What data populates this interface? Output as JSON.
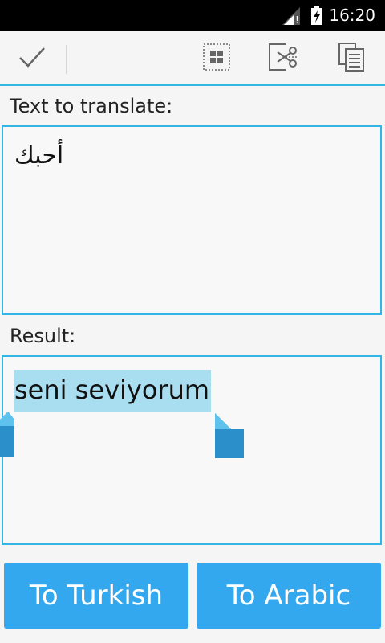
{
  "status_bar": {
    "time": "16:20",
    "signal_icon": "signal-weak-icon",
    "battery_icon": "battery-charging-icon"
  },
  "action_bar": {
    "done_icon": "checkmark-icon",
    "select_all_icon": "select-all-icon",
    "cut_icon": "cut-icon",
    "copy_icon": "copy-icon",
    "accent_color": "#33b5e5"
  },
  "input_section": {
    "label": "Text to translate:",
    "value": "أحبك"
  },
  "result_section": {
    "label": "Result:",
    "value": "seni seviyorum",
    "selection_color": "#a9def0"
  },
  "buttons": {
    "to_turkish": "To Turkish",
    "to_arabic": "To Arabic",
    "button_color": "#33a8ee"
  }
}
